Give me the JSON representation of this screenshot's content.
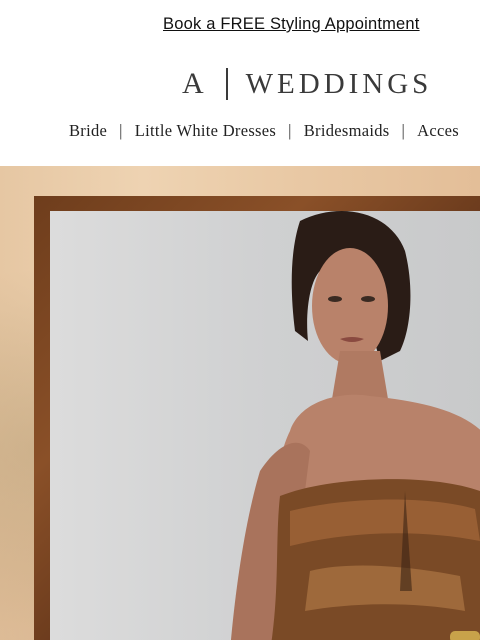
{
  "promo": {
    "link_text": "Book a FREE Styling Appointment"
  },
  "brand": {
    "letter": "A",
    "name": "WEDDINGS"
  },
  "nav": {
    "items": [
      "Bride",
      "Little White Dresses",
      "Bridesmaids",
      "Acces"
    ]
  },
  "hero": {
    "image": "model-in-metallic-strapless-dress"
  },
  "colors": {
    "frame": "#7a4522",
    "paper": "#e8c9a6",
    "photo_bg": "#d6d6d7",
    "text": "#222222"
  }
}
